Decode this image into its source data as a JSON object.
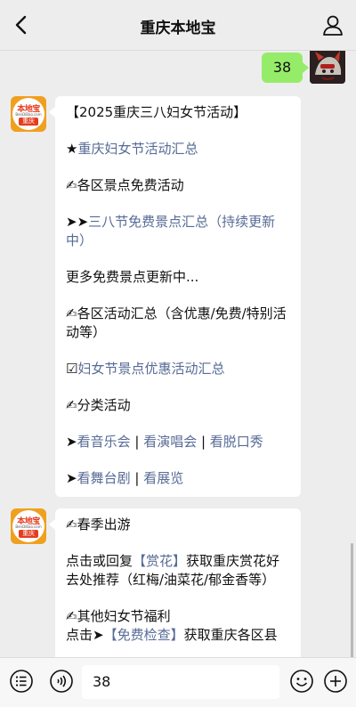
{
  "header": {
    "title": "重庆本地宝"
  },
  "outgoing": {
    "text": "38"
  },
  "bot": {
    "avatar_brand": "本地宝",
    "avatar_domain": "BenDiBao.com",
    "avatar_city": "重庆"
  },
  "message1": {
    "line1": "【2025重庆三八妇女节活动】",
    "line2_prefix": "★",
    "line2_link": "重庆妇女节活动汇总",
    "line3": "✍各区景点免费活动",
    "line4_prefix": "➤➤",
    "line4_link": "三八节免费景点汇总（持续更新中）",
    "line5": "更多免费景点更新中...",
    "line6": "✍各区活动汇总（含优惠/免费/特别活动等）",
    "line7_prefix": "☑",
    "line7_link": "妇女节景点优惠活动汇总",
    "line8": "✍分类活动",
    "line9_prefix": "➤",
    "line9_link1": "看音乐会",
    "line9_sep1": " | ",
    "line9_link2": "看演唱会",
    "line9_sep2": " | ",
    "line9_link3": "看脱口秀",
    "line10_prefix": "➤",
    "line10_link1": "看舞台剧",
    "line10_sep": " | ",
    "line10_link2": "看展览"
  },
  "message2": {
    "line1": "✍春季出游",
    "line2_a": "点击或回复",
    "line2_link": "【赏花】",
    "line2_b": "获取重庆赏花好去处推荐（红梅/油菜花/郁金香等）",
    "line3": "✍其他妇女节福利",
    "line4_a": "点击➤",
    "line4_link": "【免费检查】",
    "line4_b": "获取重庆各区县"
  },
  "composer": {
    "value": "38"
  },
  "icons": {
    "back": "chevron-left-icon",
    "profile": "person-icon",
    "voice": "voice-icon",
    "emoji": "emoji-icon",
    "plus": "plus-icon",
    "menu": "menu-list-icon"
  }
}
